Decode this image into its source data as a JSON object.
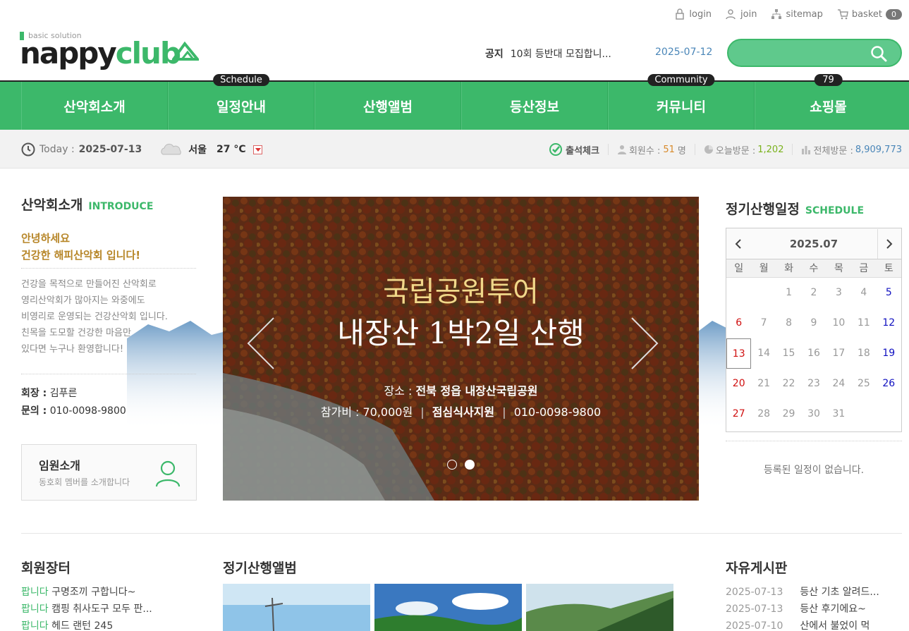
{
  "util": {
    "login": "login",
    "join": "join",
    "sitemap": "sitemap",
    "basket": "basket",
    "basket_count": "0"
  },
  "logo": {
    "sub": "basic solution",
    "main_dark": "nappy",
    "main_green": "club"
  },
  "notice": {
    "label": "공지",
    "text": "10회 등반대 모집합니...",
    "date": "2025-07-12"
  },
  "search": {
    "placeholder": ""
  },
  "nav": {
    "items": [
      {
        "label": "산악회소개",
        "badge": ""
      },
      {
        "label": "일정안내",
        "badge": "Schedule"
      },
      {
        "label": "산행앨범",
        "badge": ""
      },
      {
        "label": "등산정보",
        "badge": ""
      },
      {
        "label": "커뮤니티",
        "badge": "Community"
      },
      {
        "label": "쇼핑몰",
        "badge": "79"
      }
    ]
  },
  "infobar": {
    "today_label": "Today :",
    "today_date": "2025-07-13",
    "city": "서울",
    "temp": "27 °C",
    "attendance": "출석체크",
    "members_label": "회원수 :",
    "members_value": "51",
    "members_unit": "명",
    "today_visits_label": "오늘방문 :",
    "today_visits_value": "1,202",
    "total_visits_label": "전체방문 :",
    "total_visits_value": "8,909,773"
  },
  "intro": {
    "title": "산악회소개",
    "sub": "INTRODUCE",
    "greet1": "안녕하세요",
    "greet2": "건강한 해피산악회 입니다!",
    "lines": [
      "건강을 목적으로 만들어진 산악회로",
      "영리산악회가 많아지는 와중에도",
      "비영리로 운영되는 건강산악회 입니다.",
      "친목을 도모할 건강한 마음만",
      "있다면 누구나 환영합니다!"
    ],
    "president_label": "회장 :",
    "president_value": "김푸른",
    "contact_label": "문의 :",
    "contact_value": "010-0098-9800",
    "staff_title": "임원소개",
    "staff_desc": "동호회 멤버를 소개합니다"
  },
  "slider": {
    "title1": "국립공원투어",
    "title2": "내장산 1박2일 산행",
    "place_label": "장소 :",
    "place_value": "전북 정읍 내장산국립공원",
    "fee": "참가비 : 70,000원",
    "meal": "점심식사지원",
    "phone": "010-0098-9800"
  },
  "schedule": {
    "title": "정기산행일정",
    "sub": "SCHEDULE",
    "month": "2025.07",
    "weekdays": [
      "일",
      "월",
      "화",
      "수",
      "목",
      "금",
      "토"
    ],
    "empty_text": "등록된 일정이 없습니다."
  },
  "market": {
    "title": "회원장터",
    "items": [
      {
        "tag": "팝니다",
        "text": "구명조끼 구합니다~"
      },
      {
        "tag": "팝니다",
        "text": "캠핑 취사도구 모두 판..."
      },
      {
        "tag": "팝니다",
        "text": "헤드 랜턴 245"
      }
    ]
  },
  "album": {
    "title": "정기산행앨범"
  },
  "free": {
    "title": "자유게시판",
    "items": [
      {
        "date": "2025-07-13",
        "text": "등산 기초 알려드..."
      },
      {
        "date": "2025-07-13",
        "text": "등산 후기에요~"
      },
      {
        "date": "2025-07-10",
        "text": "산에서 불었이 먹"
      }
    ]
  },
  "colors": {
    "brand": "#3cb86a",
    "accent_orange": "#b78628"
  }
}
